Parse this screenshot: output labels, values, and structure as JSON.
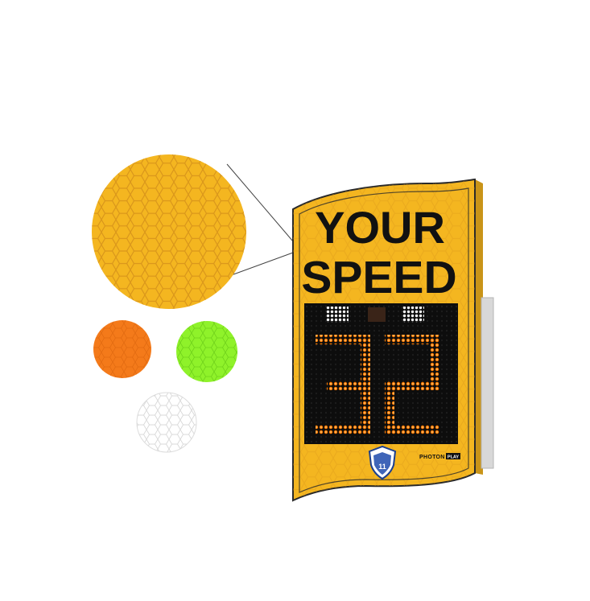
{
  "sign": {
    "line1": "YOUR",
    "line2": "SPEED",
    "speed": "32",
    "brand_text": "PHOTON",
    "brand_badge": "PLAY",
    "face_color": "#f4b620",
    "led_color": "#ff7a00",
    "display_color": "#0d0d0d"
  },
  "swatches": [
    {
      "name": "yellow",
      "color": "#f4b620"
    },
    {
      "name": "orange",
      "color": "#f47a1a"
    },
    {
      "name": "lime-green",
      "color": "#8ff22a"
    },
    {
      "name": "white",
      "color": "#ffffff"
    }
  ]
}
